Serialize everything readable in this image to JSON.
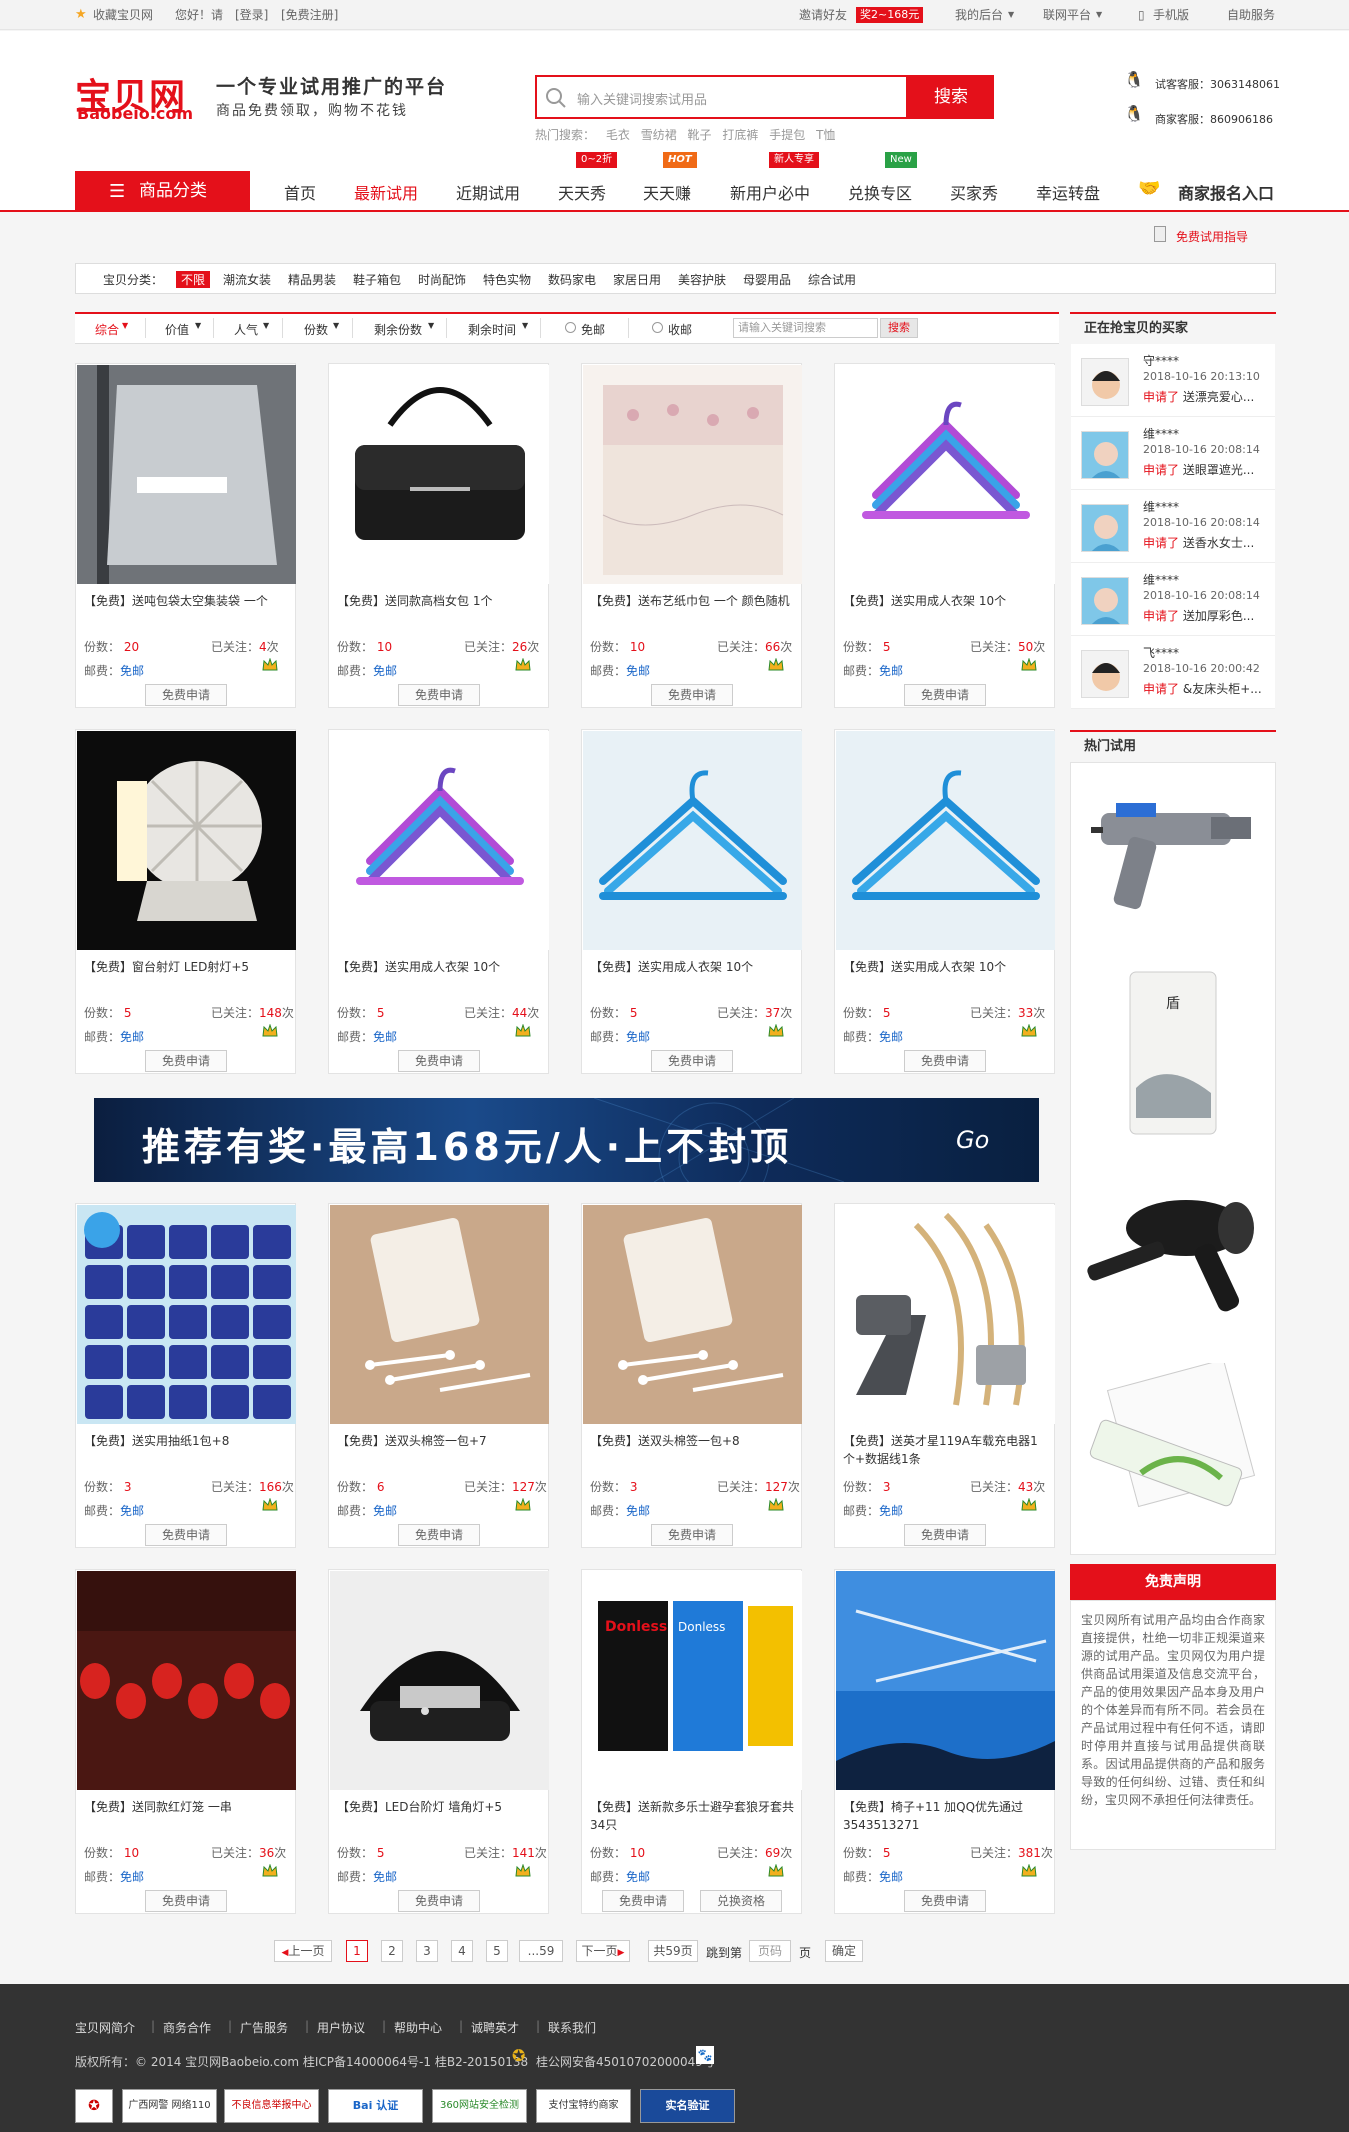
{
  "topbar": {
    "fav": "收藏宝贝网",
    "greeting": "您好！请",
    "login": "[登录]",
    "register": "[免费注册]",
    "invite": "邀请好友",
    "invite_reward": "奖2~168元",
    "my_backend": "我的后台",
    "union": "联网平台",
    "mobile": "手机版",
    "self_service": "自助服务"
  },
  "header": {
    "logo": "宝贝网",
    "logo_en": "Baobeio.com",
    "slogan": "一个专业试用推广的平台",
    "slogan2": "商品免费领取，购物不花钱",
    "search_placeholder": "输入关键词搜索试用品",
    "search_btn": "搜索",
    "hot_label": "热门搜索：",
    "hot_words": [
      "毛衣",
      "雪纺裙",
      "靴子",
      "打底裤",
      "手提包",
      "T恤"
    ],
    "service1": "试客客服：3063148061",
    "service2": "商家客服：860906186"
  },
  "nav": {
    "category": "商品分类",
    "items": [
      "首页",
      "最新试用",
      "近期试用",
      "天天秀",
      "天天赚",
      "新用户必中",
      "兑换专区",
      "买家秀",
      "幸运转盘"
    ],
    "tags": [
      "0~2折",
      "HOT",
      "新人专享",
      "New"
    ],
    "merchant": "商家报名入口"
  },
  "guide": "免费试用指导",
  "categories": {
    "label": "宝贝分类：",
    "items": [
      "不限",
      "潮流女装",
      "精品男装",
      "鞋子箱包",
      "时尚配饰",
      "特色实物",
      "数码家电",
      "家居日用",
      "美容护肤",
      "母婴用品",
      "综合试用"
    ]
  },
  "sort": {
    "items": [
      "综合",
      "价值",
      "人气",
      "份数",
      "剩余份数",
      "剩余时间"
    ],
    "radio1": "免邮",
    "radio2": "收邮",
    "placeholder": "请输入关键词搜索",
    "btn": "搜索"
  },
  "labels": {
    "count": "份数：",
    "watch": "已关注：",
    "ship": "邮费：",
    "free_ship": "免邮",
    "unit": "次",
    "apply": "免费申请",
    "exchange": "兑换资格"
  },
  "products": [
    {
      "title": "【免费】送吨包袋太空集装袋 一个",
      "count": "20",
      "watch": "4",
      "img": "bag-gray"
    },
    {
      "title": "【免费】送同款高档女包 1个",
      "count": "10",
      "watch": "26",
      "img": "handbag"
    },
    {
      "title": "【免费】送布艺纸巾包 一个 颜色随机",
      "count": "10",
      "watch": "66",
      "img": "lace"
    },
    {
      "title": "【免费】送实用成人衣架 10个",
      "count": "5",
      "watch": "50",
      "img": "hanger-purple"
    },
    {
      "title": "【免费】窗台射灯 LED射灯+5",
      "count": "5",
      "watch": "148",
      "img": "lamp"
    },
    {
      "title": "【免费】送实用成人衣架 10个",
      "count": "5",
      "watch": "44",
      "img": "hanger-purple"
    },
    {
      "title": "【免费】送实用成人衣架 10个",
      "count": "5",
      "watch": "37",
      "img": "hanger-blue"
    },
    {
      "title": "【免费】送实用成人衣架 10个",
      "count": "5",
      "watch": "33",
      "img": "hanger-blue"
    },
    {
      "title": "【免费】送实用抽纸1包+8",
      "count": "3",
      "watch": "166",
      "img": "tissue"
    },
    {
      "title": "【免费】送双头棉签一包+7",
      "count": "6",
      "watch": "127",
      "img": "swab"
    },
    {
      "title": "【免费】送双头棉签一包+8",
      "count": "3",
      "watch": "127",
      "img": "swab"
    },
    {
      "title": "【免费】送英才星119A车载充电器1个+数据线1条",
      "count": "3",
      "watch": "43",
      "img": "charger"
    },
    {
      "title": "【免费】送同款红灯笼 一串",
      "count": "10",
      "watch": "36",
      "img": "lantern"
    },
    {
      "title": "【免费】LED台阶灯 墙角灯+5",
      "count": "5",
      "watch": "141",
      "img": "steplight"
    },
    {
      "title": "【免费】送新款多乐士避孕套狼牙套共34只",
      "count": "10",
      "watch": "69",
      "img": "condom"
    },
    {
      "title": "【免费】椅子+11 加QQ优先通过3543513271",
      "count": "5",
      "watch": "381",
      "img": "sky"
    }
  ],
  "banner": {
    "text": "推荐有奖·最高168元/人·上不封顶",
    "go": "Go"
  },
  "sidebar": {
    "buyers_title": "正在抢宝贝的买家",
    "buyers": [
      {
        "name": "守****",
        "date": "2018-10-16 20:13:10",
        "action": "申请了",
        "item": "送漂亮爱心..."
      },
      {
        "name": "维****",
        "date": "2018-10-16 20:08:14",
        "action": "申请了",
        "item": "送眼罩遮光..."
      },
      {
        "name": "维****",
        "date": "2018-10-16 20:08:14",
        "action": "申请了",
        "item": "送香水女士..."
      },
      {
        "name": "维****",
        "date": "2018-10-16 20:08:14",
        "action": "申请了",
        "item": "送加厚彩色..."
      },
      {
        "name": "飞****",
        "date": "2018-10-16 20:00:42",
        "action": "申请了",
        "item": "&友床头柜+..."
      }
    ],
    "hot_title": "热门试用",
    "disclaimer_title": "免责声明",
    "disclaimer": "宝贝网所有试用产品均由合作商家直接提供，杜绝一切非正规渠道来源的试用产品。宝贝网仅为用户提供商品试用渠道及信息交流平台，产品的使用效果因产品本身及用户的个体差异而有所不同。若会员在产品试用过程中有任何不适，请即时停用并直接与试用品提供商联系。因试用品提供商的产品和服务导致的任何纠纷、过错、责任和纠纷，宝贝网不承担任何法律责任。"
  },
  "pager": {
    "prev": "上一页",
    "pages": [
      "1",
      "2",
      "3",
      "4",
      "5"
    ],
    "ellipsis": "...59",
    "next": "下一页",
    "total": "共59页",
    "goto": "跳到第",
    "input": "页码",
    "page": "页",
    "confirm": "确定"
  },
  "footer": {
    "links": [
      "宝贝网简介",
      "商务合作",
      "广告服务",
      "用户协议",
      "帮助中心",
      "诚聘英才",
      "联系我们"
    ],
    "copyright": "版权所有：© 2014 宝贝网Baobeio.com 桂ICP备14000064号-1 桂B2-20150138",
    "police": "桂公网安备45010702000049号",
    "badges": [
      "广西网警 网络110",
      "不良信息举报中心",
      "Bai 认证",
      "360网站安全检测",
      "支付宝特约商家",
      "实名验证"
    ]
  },
  "colors": {
    "accent": "#e4101a",
    "link_blue": "#1a66c8",
    "footer_bg": "#333333"
  }
}
